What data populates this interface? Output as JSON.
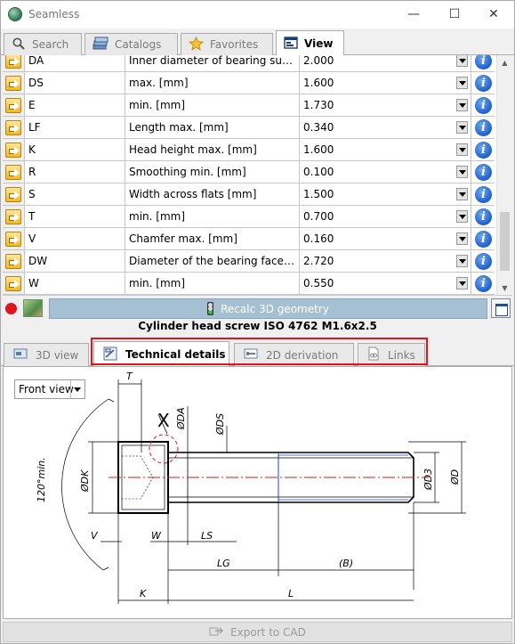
{
  "window": {
    "title": "Seamless"
  },
  "top_tabs": [
    {
      "label": "Search",
      "icon": "search-icon"
    },
    {
      "label": "Catalogs",
      "icon": "catalogs-icon"
    },
    {
      "label": "Favorites",
      "icon": "star-icon"
    },
    {
      "label": "View",
      "icon": "view-icon",
      "active": true
    }
  ],
  "properties": [
    {
      "name": "DA",
      "description": "Inner diameter of bearing surface ...",
      "value": "2.000"
    },
    {
      "name": "DS",
      "description": "max. [mm]",
      "value": "1.600"
    },
    {
      "name": "E",
      "description": "min. [mm]",
      "value": "1.730"
    },
    {
      "name": "LF",
      "description": "Length max. [mm]",
      "value": "0.340"
    },
    {
      "name": "K",
      "description": "Head height max. [mm]",
      "value": "1.600"
    },
    {
      "name": "R",
      "description": "Smoothing min. [mm]",
      "value": "0.100"
    },
    {
      "name": "S",
      "description": "Width across flats [mm]",
      "value": "1.500"
    },
    {
      "name": "T",
      "description": "min. [mm]",
      "value": "0.700"
    },
    {
      "name": "V",
      "description": "Chamfer max. [mm]",
      "value": "0.160"
    },
    {
      "name": "DW",
      "description": "Diameter of the bearing face min. ...",
      "value": "2.720"
    },
    {
      "name": "W",
      "description": "min. [mm]",
      "value": "0.550"
    }
  ],
  "recalc": {
    "label": "Recalc 3D geometry"
  },
  "part_title": "Cylinder head screw  ISO 4762  M1.6x2.5",
  "bottom_tabs": [
    {
      "label": "3D view",
      "icon": "3d-view-icon"
    },
    {
      "label": "Technical details",
      "icon": "technical-details-icon",
      "active": true
    },
    {
      "label": "2D derivation",
      "icon": "2d-derivation-icon"
    },
    {
      "label": "Links",
      "icon": "links-icon"
    }
  ],
  "view_select": {
    "value": "Front view"
  },
  "drawing_labels": {
    "t": "T",
    "x": "X",
    "da": "ØDA",
    "ds": "ØDS",
    "angle": "120°min.",
    "dk": "ØDK",
    "d3": "ØD3",
    "d": "ØD",
    "v": "V",
    "w": "W",
    "ls": "LS",
    "lg": "LG",
    "b": "(B)",
    "k": "K",
    "l": "L"
  },
  "export": {
    "label": "Export to CAD"
  },
  "colors": {
    "highlight": "#e8101a",
    "accent_button": "#a6c0d3",
    "info": "#1c5fcf"
  }
}
